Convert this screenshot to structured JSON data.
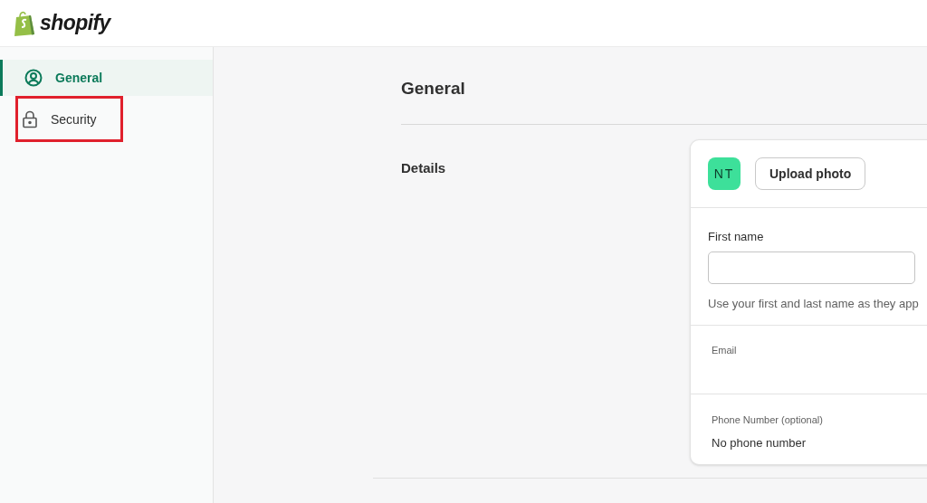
{
  "header": {
    "logo_text": "shopify"
  },
  "sidebar": {
    "items": [
      {
        "label": "General",
        "kind": "person",
        "selected": true,
        "highlighted": false
      },
      {
        "label": "Security",
        "kind": "lock",
        "selected": false,
        "highlighted": true
      }
    ]
  },
  "page": {
    "title": "General",
    "section_label": "Details",
    "avatar": {
      "initials": "NT",
      "color": "#3de09a"
    },
    "upload_button": "Upload photo",
    "first_name": {
      "label": "First name",
      "hint": "Use your first and last name as they app"
    },
    "email": {
      "label": "Email"
    },
    "phone": {
      "label": "Phone Number (optional)",
      "value": "No phone number"
    }
  }
}
